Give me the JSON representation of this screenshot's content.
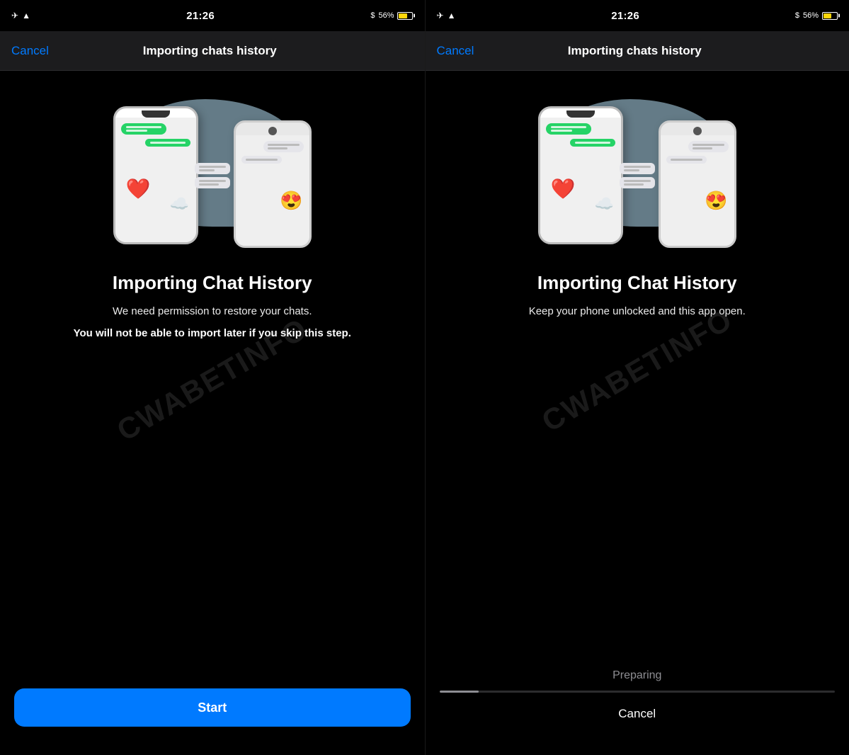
{
  "left_panel": {
    "status_bar": {
      "time": "21:26",
      "battery_percent": "56%"
    },
    "nav": {
      "cancel_label": "Cancel",
      "title": "Importing chats history"
    },
    "heading": "Importing Chat History",
    "subtext": "We need permission to restore your chats.",
    "bold_warning": "You will not be able to import later if you skip this step.",
    "start_button_label": "Start"
  },
  "right_panel": {
    "status_bar": {
      "time": "21:26",
      "battery_percent": "56%"
    },
    "nav": {
      "cancel_label": "Cancel",
      "title": "Importing chats history"
    },
    "heading": "Importing Chat History",
    "subtext": "Keep your phone unlocked and this app open.",
    "preparing_label": "Preparing",
    "cancel_button_label": "Cancel"
  },
  "watermark": "CWABETINFO"
}
